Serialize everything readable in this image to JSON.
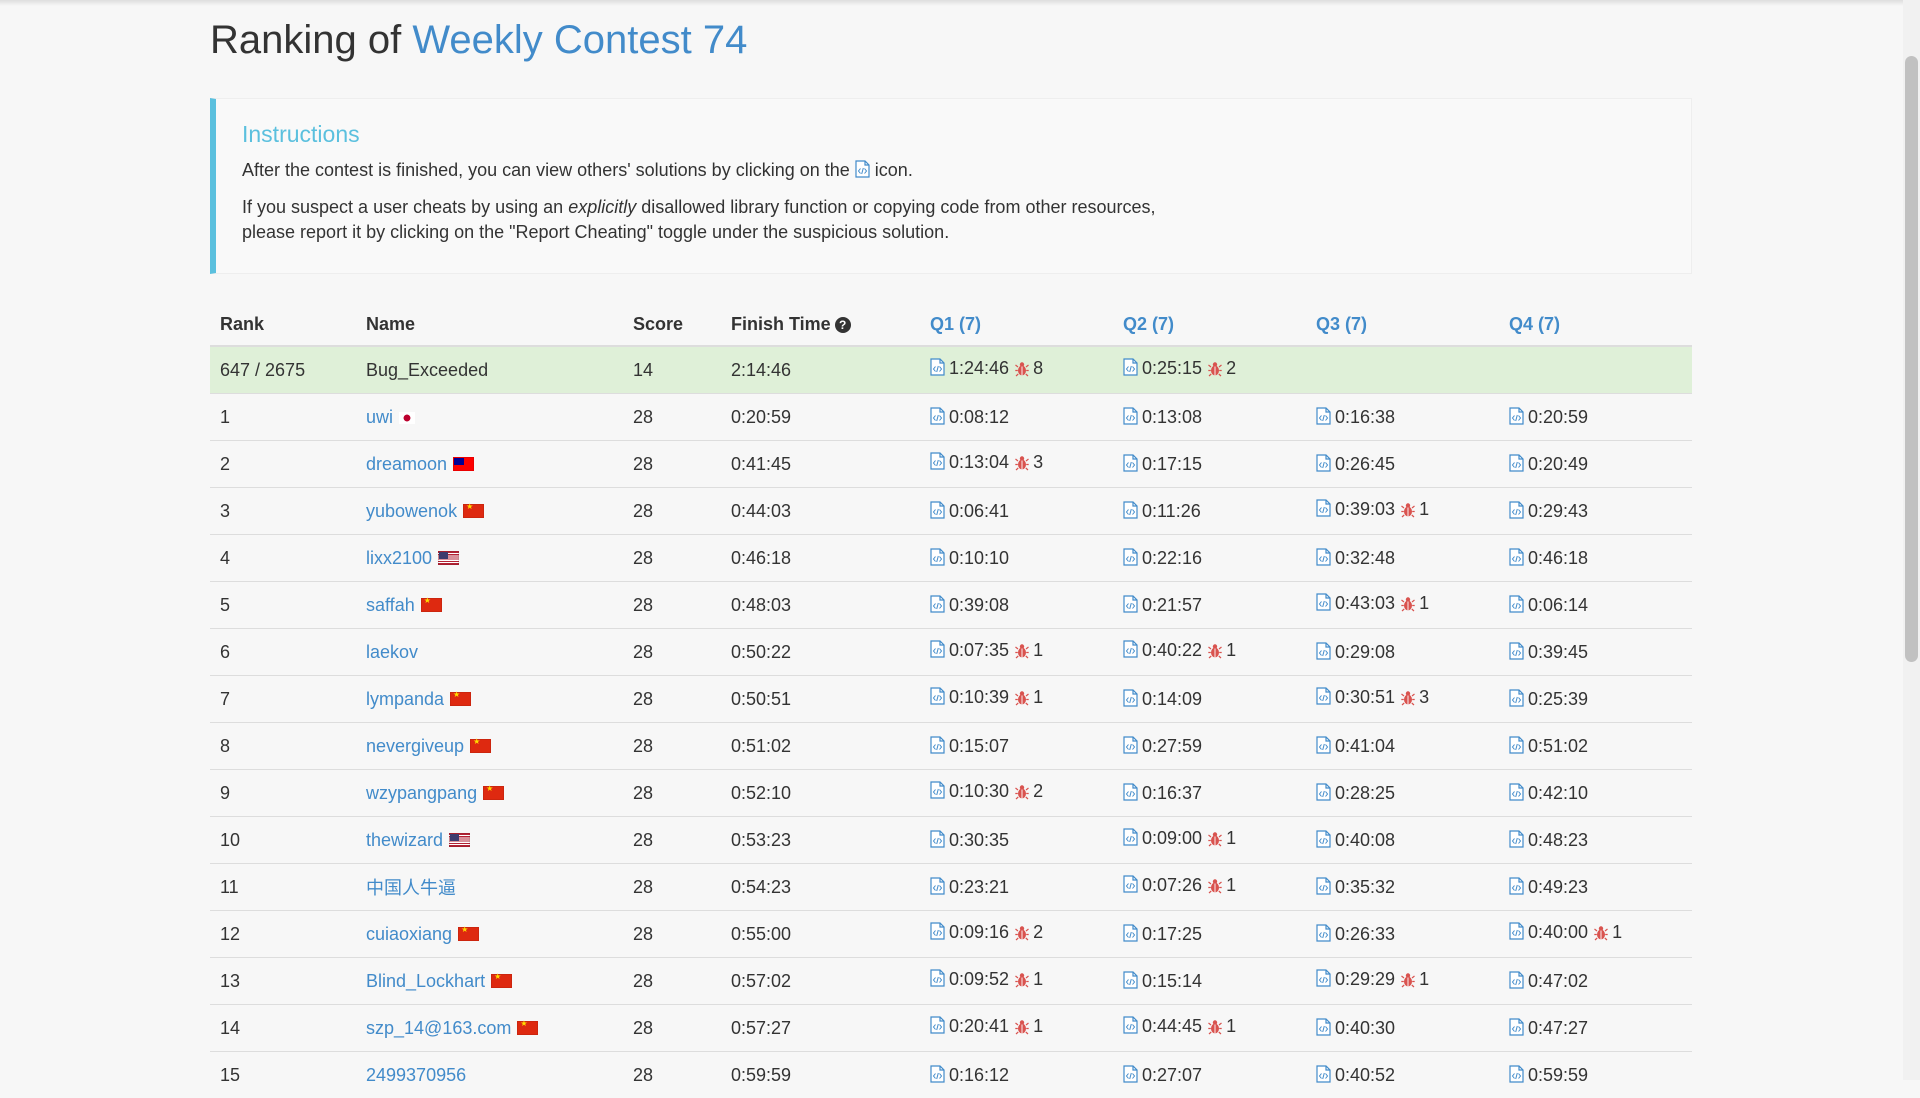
{
  "page": {
    "title_prefix": "Ranking of",
    "title_contest": "Weekly Contest 74"
  },
  "instructions": {
    "heading": "Instructions",
    "line1_before": "After the contest is finished, you can view others' solutions by clicking on the",
    "line1_after": "icon.",
    "line2_before": "If you suspect a user cheats by using an",
    "line2_em": "explicitly",
    "line2_after": "disallowed library function or copying code from other resources,",
    "line3": "please report it by clicking on the \"Report Cheating\" toggle under the suspicious solution."
  },
  "table": {
    "headers": {
      "rank": "Rank",
      "name": "Name",
      "score": "Score",
      "finish": "Finish Time",
      "finish_help": "?",
      "q1": "Q1 (7)",
      "q2": "Q2 (7)",
      "q3": "Q3 (7)",
      "q4": "Q4 (7)"
    },
    "me": {
      "rank": "647 / 2675",
      "name": "Bug_Exceeded",
      "score": "14",
      "finish": "2:14:46",
      "q1": {
        "time": "1:24:46",
        "bugs": "8"
      },
      "q2": {
        "time": "0:25:15",
        "bugs": "2"
      }
    },
    "rows": [
      {
        "rank": "1",
        "name": "uwi",
        "flag": "jp",
        "score": "28",
        "finish": "0:20:59",
        "q": [
          {
            "t": "0:08:12"
          },
          {
            "t": "0:13:08"
          },
          {
            "t": "0:16:38"
          },
          {
            "t": "0:20:59"
          }
        ]
      },
      {
        "rank": "2",
        "name": "dreamoon",
        "flag": "tw",
        "score": "28",
        "finish": "0:41:45",
        "q": [
          {
            "t": "0:13:04",
            "b": "3"
          },
          {
            "t": "0:17:15"
          },
          {
            "t": "0:26:45"
          },
          {
            "t": "0:20:49"
          }
        ]
      },
      {
        "rank": "3",
        "name": "yubowenok",
        "flag": "cn",
        "score": "28",
        "finish": "0:44:03",
        "q": [
          {
            "t": "0:06:41"
          },
          {
            "t": "0:11:26"
          },
          {
            "t": "0:39:03",
            "b": "1"
          },
          {
            "t": "0:29:43"
          }
        ]
      },
      {
        "rank": "4",
        "name": "lixx2100",
        "flag": "us",
        "score": "28",
        "finish": "0:46:18",
        "q": [
          {
            "t": "0:10:10"
          },
          {
            "t": "0:22:16"
          },
          {
            "t": "0:32:48"
          },
          {
            "t": "0:46:18"
          }
        ]
      },
      {
        "rank": "5",
        "name": "saffah",
        "flag": "cn",
        "score": "28",
        "finish": "0:48:03",
        "q": [
          {
            "t": "0:39:08"
          },
          {
            "t": "0:21:57"
          },
          {
            "t": "0:43:03",
            "b": "1"
          },
          {
            "t": "0:06:14"
          }
        ]
      },
      {
        "rank": "6",
        "name": "laekov",
        "flag": "",
        "score": "28",
        "finish": "0:50:22",
        "q": [
          {
            "t": "0:07:35",
            "b": "1"
          },
          {
            "t": "0:40:22",
            "b": "1"
          },
          {
            "t": "0:29:08"
          },
          {
            "t": "0:39:45"
          }
        ]
      },
      {
        "rank": "7",
        "name": "lympanda",
        "flag": "cn",
        "score": "28",
        "finish": "0:50:51",
        "q": [
          {
            "t": "0:10:39",
            "b": "1"
          },
          {
            "t": "0:14:09"
          },
          {
            "t": "0:30:51",
            "b": "3"
          },
          {
            "t": "0:25:39"
          }
        ]
      },
      {
        "rank": "8",
        "name": "nevergiveup",
        "flag": "cn",
        "score": "28",
        "finish": "0:51:02",
        "q": [
          {
            "t": "0:15:07"
          },
          {
            "t": "0:27:59"
          },
          {
            "t": "0:41:04"
          },
          {
            "t": "0:51:02"
          }
        ]
      },
      {
        "rank": "9",
        "name": "wzypangpang",
        "flag": "cn",
        "score": "28",
        "finish": "0:52:10",
        "q": [
          {
            "t": "0:10:30",
            "b": "2"
          },
          {
            "t": "0:16:37"
          },
          {
            "t": "0:28:25"
          },
          {
            "t": "0:42:10"
          }
        ]
      },
      {
        "rank": "10",
        "name": "thewizard",
        "flag": "us",
        "score": "28",
        "finish": "0:53:23",
        "q": [
          {
            "t": "0:30:35"
          },
          {
            "t": "0:09:00",
            "b": "1"
          },
          {
            "t": "0:40:08"
          },
          {
            "t": "0:48:23"
          }
        ]
      },
      {
        "rank": "11",
        "name": "中国人牛逼",
        "flag": "",
        "score": "28",
        "finish": "0:54:23",
        "q": [
          {
            "t": "0:23:21"
          },
          {
            "t": "0:07:26",
            "b": "1"
          },
          {
            "t": "0:35:32"
          },
          {
            "t": "0:49:23"
          }
        ]
      },
      {
        "rank": "12",
        "name": "cuiaoxiang",
        "flag": "cn",
        "score": "28",
        "finish": "0:55:00",
        "q": [
          {
            "t": "0:09:16",
            "b": "2"
          },
          {
            "t": "0:17:25"
          },
          {
            "t": "0:26:33"
          },
          {
            "t": "0:40:00",
            "b": "1"
          }
        ]
      },
      {
        "rank": "13",
        "name": "Blind_Lockhart",
        "flag": "cn",
        "score": "28",
        "finish": "0:57:02",
        "q": [
          {
            "t": "0:09:52",
            "b": "1"
          },
          {
            "t": "0:15:14"
          },
          {
            "t": "0:29:29",
            "b": "1"
          },
          {
            "t": "0:47:02"
          }
        ]
      },
      {
        "rank": "14",
        "name": "szp_14@163.com",
        "flag": "cn",
        "score": "28",
        "finish": "0:57:27",
        "q": [
          {
            "t": "0:20:41",
            "b": "1"
          },
          {
            "t": "0:44:45",
            "b": "1"
          },
          {
            "t": "0:40:30"
          },
          {
            "t": "0:47:27"
          }
        ]
      },
      {
        "rank": "15",
        "name": "2499370956",
        "flag": "",
        "score": "28",
        "finish": "0:59:59",
        "q": [
          {
            "t": "0:16:12"
          },
          {
            "t": "0:27:07"
          },
          {
            "t": "0:40:52"
          },
          {
            "t": "0:59:59"
          }
        ]
      }
    ]
  },
  "colors": {
    "link": "#428bca",
    "info": "#5bc0de",
    "highlight_row": "#dff0d8",
    "bug": "#d9534f"
  },
  "icons": {
    "code": "code-file-icon",
    "bug": "bug-icon",
    "help": "question-circle-icon"
  }
}
